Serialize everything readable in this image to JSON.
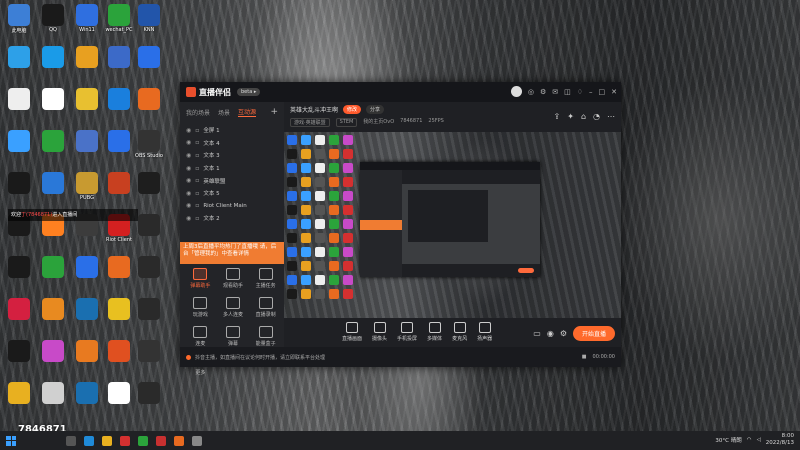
{
  "desktop": {
    "icons": [
      {
        "label": "此电脑",
        "color": "#3d7fd6"
      },
      {
        "label": "QQ",
        "color": "#1a1a1a"
      },
      {
        "label": "Win11",
        "color": "#2f6fe0"
      },
      {
        "label": "wechat_PC",
        "color": "#2ba33b"
      },
      {
        "label": "KNN",
        "color": "#2255aa"
      },
      {
        "label": "",
        "color": "#2da0e8"
      },
      {
        "label": "",
        "color": "#1a9be8"
      },
      {
        "label": "",
        "color": "#e8a020"
      },
      {
        "label": "",
        "color": "#3c6ac8"
      },
      {
        "label": "",
        "color": "#2a6fe8"
      },
      {
        "label": "",
        "color": "#eeeeee"
      },
      {
        "label": "",
        "color": "#ffffff"
      },
      {
        "label": "",
        "color": "#e8c030"
      },
      {
        "label": "",
        "color": "#1a7fdd"
      },
      {
        "label": "",
        "color": "#e86a20"
      },
      {
        "label": "",
        "color": "#3aa0ff"
      },
      {
        "label": "",
        "color": "#2ba33b"
      },
      {
        "label": "",
        "color": "#4a72c8"
      },
      {
        "label": "",
        "color": "#2a6fe8"
      },
      {
        "label": "OBS Studio",
        "color": "#333333"
      },
      {
        "label": "",
        "color": "#1a1a1a"
      },
      {
        "label": "",
        "color": "#2a78d8"
      },
      {
        "label": "PUBG",
        "color": "#c89a30"
      },
      {
        "label": "",
        "color": "#c84020"
      },
      {
        "label": "",
        "color": "#1e1e1e"
      },
      {
        "label": "",
        "color": "#1a1a1a"
      },
      {
        "label": "",
        "color": "#ff8020"
      },
      {
        "label": "",
        "color": "#3c3c3c"
      },
      {
        "label": "Riot Client",
        "color": "#d42020"
      },
      {
        "label": "",
        "color": "#2a2a2a"
      },
      {
        "label": "",
        "color": "#1a1a1a"
      },
      {
        "label": "",
        "color": "#2ba33b"
      },
      {
        "label": "",
        "color": "#2a6fe8"
      },
      {
        "label": "",
        "color": "#e86a20"
      },
      {
        "label": "",
        "color": "#2a2a2a"
      },
      {
        "label": "",
        "color": "#d42040"
      },
      {
        "label": "",
        "color": "#e88a20"
      },
      {
        "label": "",
        "color": "#1a6fb0"
      },
      {
        "label": "",
        "color": "#e8c020"
      },
      {
        "label": "",
        "color": "#2a2a2a"
      },
      {
        "label": "",
        "color": "#1a1a1a"
      },
      {
        "label": "",
        "color": "#c84ac8"
      },
      {
        "label": "",
        "color": "#e87a20"
      },
      {
        "label": "",
        "color": "#e05020"
      },
      {
        "label": "",
        "color": "#333333"
      },
      {
        "label": "",
        "color": "#e8b020"
      },
      {
        "label": "",
        "color": "#d0d0d0"
      },
      {
        "label": "",
        "color": "#1a6fb0"
      },
      {
        "label": "",
        "color": "#ffffff"
      },
      {
        "label": "",
        "color": "#2a2a2a"
      }
    ],
    "notice": {
      "prefix": "欢迎",
      "highlight": "丁(7846871)",
      "suffix": "进入直播间"
    },
    "room_id": "7846871"
  },
  "app": {
    "name": "直播伴侣",
    "version_badge": "beta ▸",
    "titlebar_icons": [
      "headset-icon",
      "settings-icon",
      "mail-icon",
      "message-icon",
      "shirt-icon",
      "minimize-icon",
      "maximize-icon",
      "close-icon"
    ]
  },
  "left": {
    "tabs": [
      "我的场景",
      "场景",
      "互动源"
    ],
    "active_tab": 2,
    "add_label": "+",
    "sources": [
      "全屏 1",
      "文本 4",
      "文本 3",
      "文本 1",
      "英雄联盟",
      "文本 5",
      "Riot Client Main",
      "文本 2"
    ],
    "tip": "上周3后直播平均热门了直播哦 请，后台「管理我的」中查看详情",
    "tools": [
      "弹幕助手",
      "观看助手",
      "主播任务",
      "玩游戏",
      "多人连麦",
      "直播录制",
      "连麦",
      "弹幕",
      "能量盒子",
      "更多",
      "",
      ""
    ]
  },
  "stream": {
    "title": "英雄大乱斗冲王啊",
    "edit_label": "修改",
    "share_label": "分享",
    "tags": [
      "游戏·英雄联盟",
      "STEM"
    ],
    "room_label": "我的主页OvO",
    "room_id": "7846871",
    "fps_label": "25FPS",
    "info_icons": [
      "share-icon",
      "gift-icon",
      "home-icon",
      "bell-icon",
      "more-icon"
    ]
  },
  "bottom": {
    "tools": [
      "直播画面",
      "摄像头",
      "手机投屏",
      "多媒体",
      "麦克风",
      "扬声器"
    ],
    "start_label": "开始直播"
  },
  "status": {
    "text": "抖音主播，如直播间在议论何时开播，请立即联系平台处理",
    "right": [
      "■",
      "00:00:00"
    ]
  },
  "taskbar": {
    "weather": "30°C 晴朗",
    "time": "8:00",
    "date": "2022/8/13"
  }
}
